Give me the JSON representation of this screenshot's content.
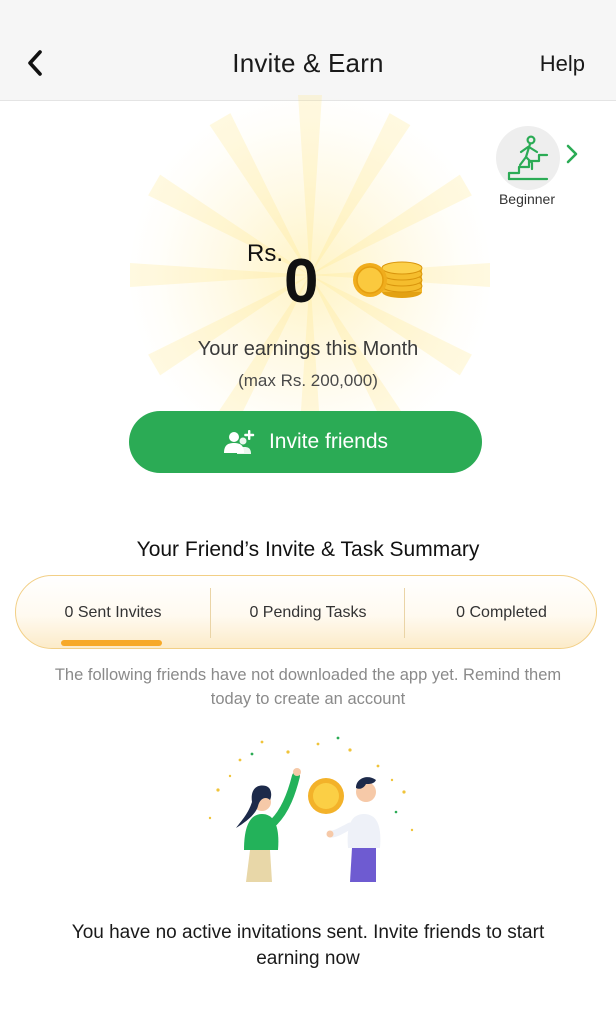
{
  "header": {
    "title": "Invite & Earn",
    "help_label": "Help",
    "back_icon": "chevron-left-icon"
  },
  "level": {
    "label": "Beginner",
    "icon": "climbing-stairs-icon",
    "color": "#2bab55"
  },
  "earnings": {
    "currency": "Rs.",
    "amount": "0",
    "label": "Your earnings this Month",
    "max": "(max Rs. 200,000)"
  },
  "invite_button": {
    "label": "Invite friends",
    "icon": "add-user-icon",
    "color": "#2bab55"
  },
  "summary": {
    "title": "Your Friend’s Invite & Task Summary",
    "tabs": [
      {
        "label": "0 Sent Invites",
        "active": true
      },
      {
        "label": "0 Pending Tasks",
        "active": false
      },
      {
        "label": "0 Completed",
        "active": false
      }
    ],
    "indicator_color": "#f7a928"
  },
  "note": "The following friends have not downloaded the app yet. Remind them today to create an account",
  "empty_message": "You have no active invitations sent. Invite friends to start earning now"
}
